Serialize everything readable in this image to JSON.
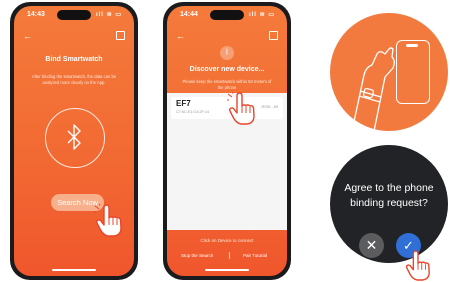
{
  "phone1": {
    "time": "14:43",
    "status_icons": "ıll ≋ ▭",
    "title": "Bind Smartwatch",
    "subtitle": "After binding the smartwatch, the data can be analyzed more clearly on the App.",
    "search_button": "Search Now"
  },
  "phone2": {
    "time": "14:44",
    "status_icons": "ıll ≋ ▭",
    "title": "Discover new device...",
    "subtitle": "Please keep the smartwatch within 50 meters of the phone",
    "device": {
      "name": "EF7",
      "mac": "C7:6C:E1:C4:2F:14",
      "signal": "RSSI: -69"
    },
    "hint": "Click on Device to connect",
    "stop_button": "Stop the Search",
    "tutorial_button": "Pair Tutorial"
  },
  "watch_prompt": {
    "question": "Agree to the phone binding request?"
  },
  "colors": {
    "orange": "#f26a33",
    "watch_bg": "#222326",
    "confirm_blue": "#2f6fd6",
    "cancel_gray": "#5c5c5f"
  }
}
